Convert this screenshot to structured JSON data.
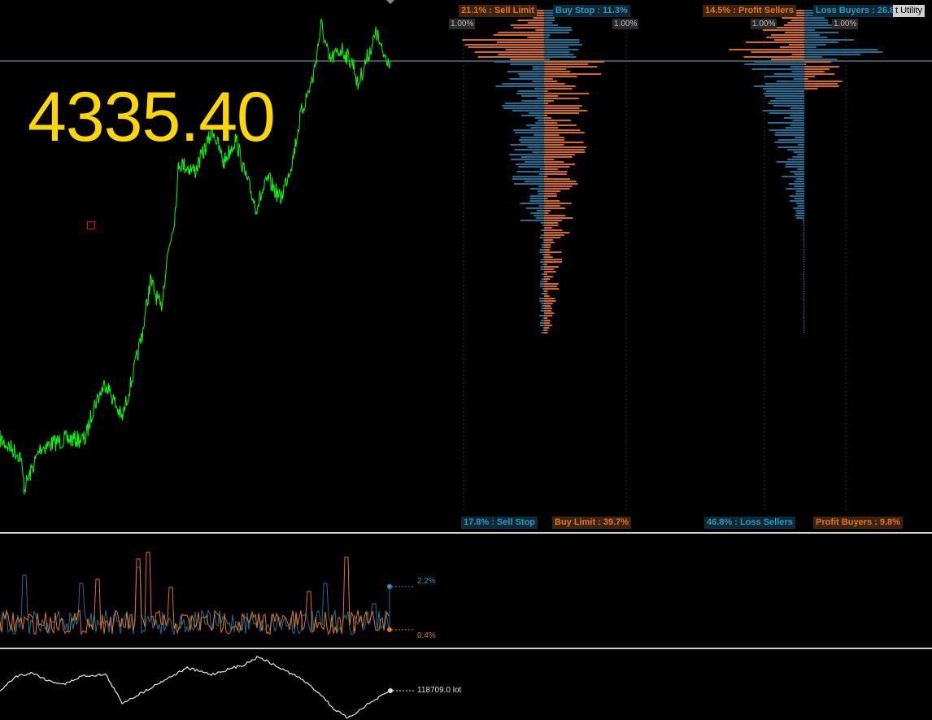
{
  "price": {
    "current": "4335.40"
  },
  "order_book": {
    "sell_limit": "21.1% : Sell Limit",
    "buy_stop": "Buy Stop : 11.3%",
    "sell_stop": "17.8% : Sell Stop",
    "buy_limit": "Buy Limit : 39.7%",
    "scale_left": "1.00%",
    "scale_right": "1.00%"
  },
  "position_book": {
    "profit_sellers": "14.5% : Profit Sellers",
    "loss_buyers": "Loss Buyers : 26.8%",
    "loss_sellers": "46.8% : Loss Sellers",
    "profit_buyers": "Profit Buyers : 9.8%",
    "scale_left": "1.00%",
    "scale_right": "1.00%"
  },
  "toolbar": {
    "utility_label": "t Utility"
  },
  "oscillator": {
    "blue_value": "2.2%",
    "orange_value": "0.4%"
  },
  "volume": {
    "value": "118709.0 lot"
  },
  "colors": {
    "price_line": "#00ff00",
    "price_text": "#ffd700",
    "orange": "#d2691e",
    "blue": "#1f6e94",
    "crosshair": "#8fa7b8"
  },
  "icons": {
    "marker": "square-outline-icon",
    "top_marker": "triangle-down-icon"
  }
}
